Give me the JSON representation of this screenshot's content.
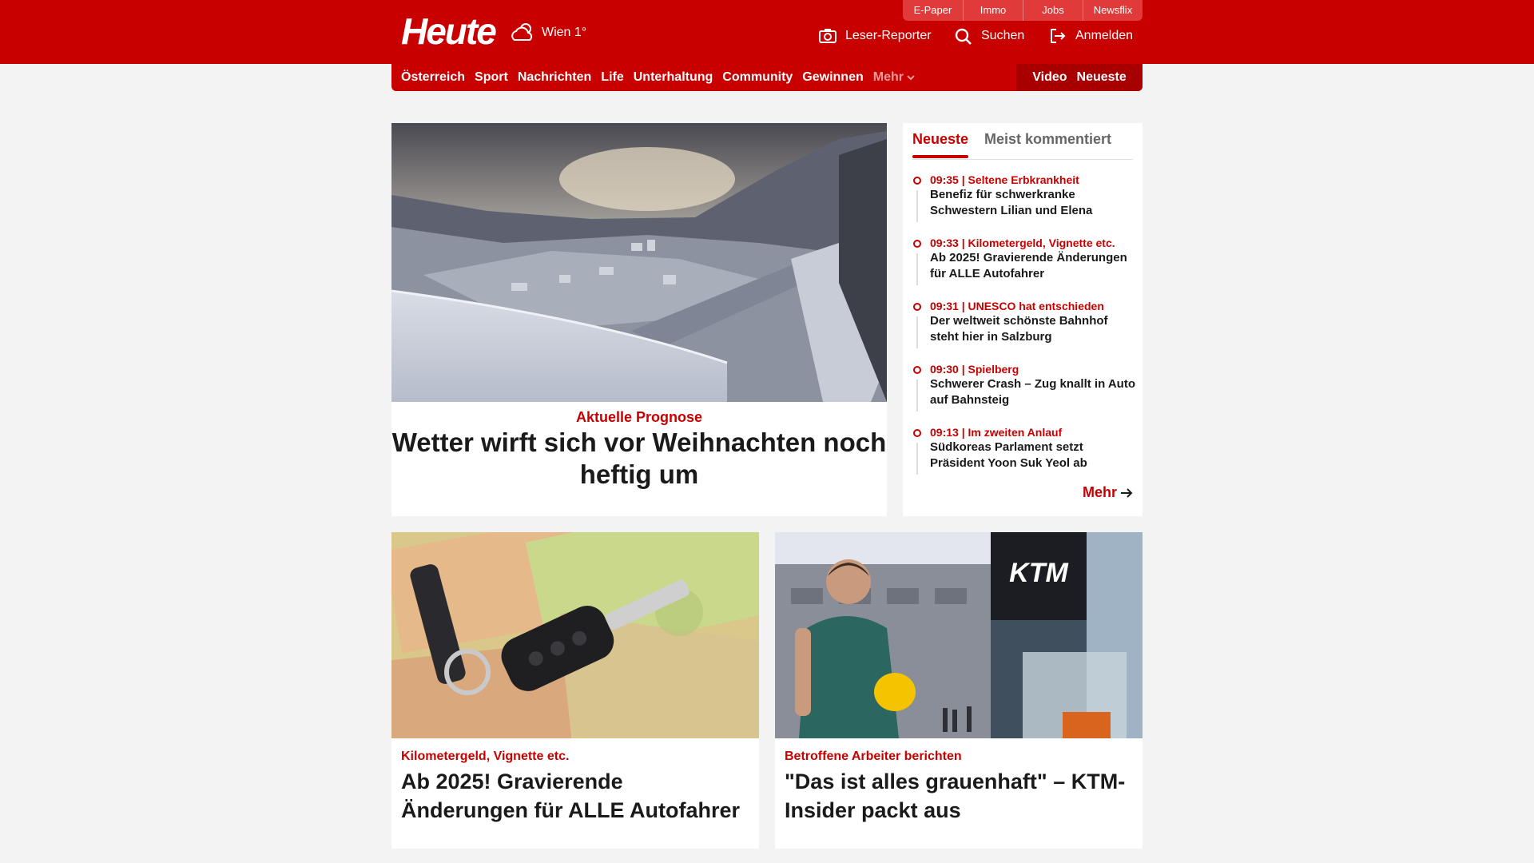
{
  "header": {
    "logo": "Heute",
    "weather": "Wien 1°",
    "service_tabs": [
      "E-Paper",
      "Immo",
      "Jobs",
      "Newsflix"
    ],
    "leser_reporter": "Leser-Reporter",
    "search": "Suchen",
    "login": "Anmelden",
    "brand_color": "#c80000"
  },
  "nav": {
    "items": [
      "Österreich",
      "Sport",
      "Nachrichten",
      "Life",
      "Unterhaltung",
      "Community",
      "Gewinnen"
    ],
    "more": "Mehr",
    "video": "Video",
    "neueste": "Neueste"
  },
  "hero": {
    "kicker": "Aktuelle Prognose",
    "title": "Wetter wirft sich vor Weihnachten noch heftig um"
  },
  "ticker": {
    "tab_active": "Neueste",
    "tab_inactive": "Meist kommentiert",
    "items": [
      {
        "meta": "09:35 | Seltene Erbkrankheit",
        "title": "Benefiz für schwerkranke Schwestern Lilian und Elena"
      },
      {
        "meta": "09:33 | Kilometergeld, Vignette etc.",
        "title": "Ab 2025! Gravierende Änderungen für ALLE Autofahrer"
      },
      {
        "meta": "09:31 | UNESCO hat entschieden",
        "title": "Der weltweit schönste Bahnhof steht hier in Salzburg"
      },
      {
        "meta": "09:30 | Spielberg",
        "title": "Schwerer Crash – Zug knallt in Auto auf Bahnsteig"
      },
      {
        "meta": "09:13 | Im zweiten Anlauf",
        "title": "Südkoreas Parlament setzt Präsident Yoon Suk Yeol ab"
      }
    ],
    "more": "Mehr"
  },
  "cards": [
    {
      "kicker": "Kilometergeld, Vignette etc.",
      "title": "Ab 2025! Gravierende Änderungen für ALLE Autofahrer"
    },
    {
      "kicker": "Betroffene Arbeiter berichten",
      "title": "\"Das ist alles grauenhaft\" – KTM-Insider packt aus",
      "sign_text": "KTM"
    }
  ]
}
